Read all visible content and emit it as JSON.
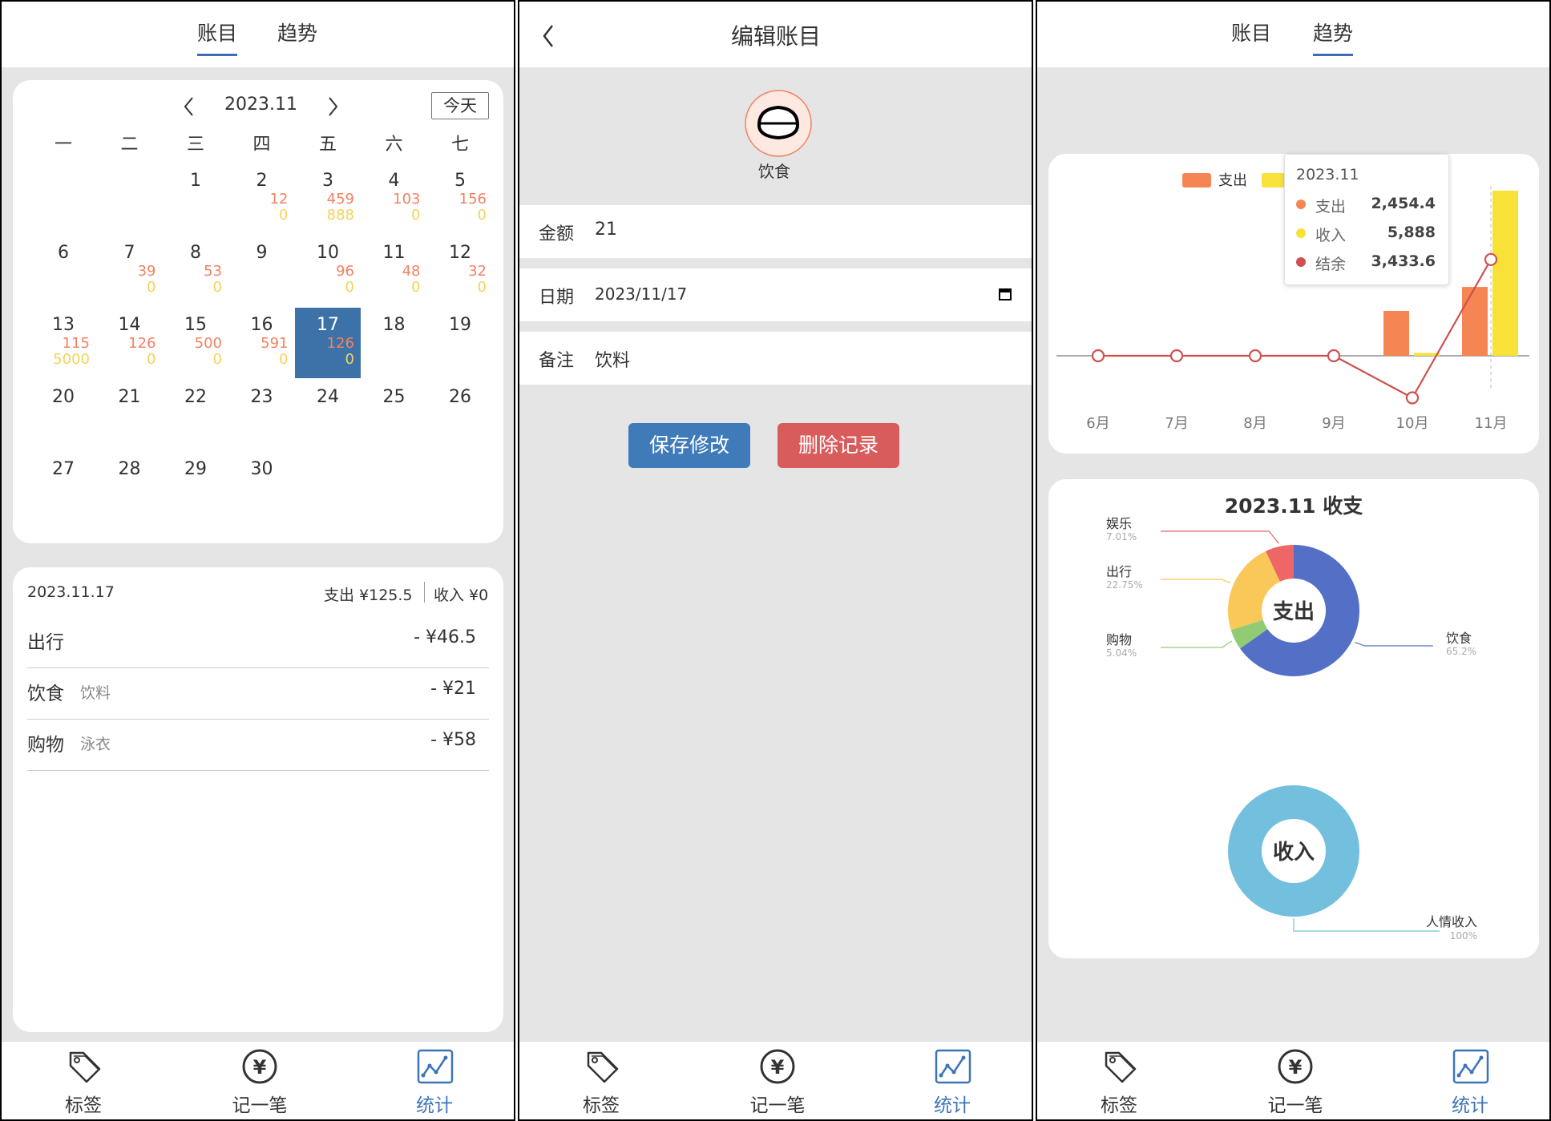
{
  "nav": {
    "items": [
      {
        "label": "标签",
        "icon": "tag-icon"
      },
      {
        "label": "记一笔",
        "icon": "yen-circle-icon"
      },
      {
        "label": "统计",
        "icon": "chart-icon"
      }
    ],
    "active_color": "#3c74b8"
  },
  "panel1": {
    "tabs": [
      "账目",
      "趋势"
    ],
    "active_tab": "账目",
    "calendar": {
      "month": "2023.11",
      "today_btn": "今天",
      "weekdays": [
        "一",
        "二",
        "三",
        "四",
        "五",
        "六",
        "七"
      ],
      "selected_day": "17",
      "days": [
        {
          "d": "1",
          "col": 2,
          "row": 0,
          "exp": "",
          "inc": ""
        },
        {
          "d": "2",
          "col": 3,
          "row": 0,
          "exp": "12",
          "inc": "0"
        },
        {
          "d": "3",
          "col": 4,
          "row": 0,
          "exp": "459",
          "inc": "888"
        },
        {
          "d": "4",
          "col": 5,
          "row": 0,
          "exp": "103",
          "inc": "0"
        },
        {
          "d": "5",
          "col": 6,
          "row": 0,
          "exp": "156",
          "inc": "0"
        },
        {
          "d": "6",
          "col": 0,
          "row": 1,
          "exp": "",
          "inc": ""
        },
        {
          "d": "7",
          "col": 1,
          "row": 1,
          "exp": "39",
          "inc": "0"
        },
        {
          "d": "8",
          "col": 2,
          "row": 1,
          "exp": "53",
          "inc": "0"
        },
        {
          "d": "9",
          "col": 3,
          "row": 1,
          "exp": "",
          "inc": ""
        },
        {
          "d": "10",
          "col": 4,
          "row": 1,
          "exp": "96",
          "inc": "0"
        },
        {
          "d": "11",
          "col": 5,
          "row": 1,
          "exp": "48",
          "inc": "0"
        },
        {
          "d": "12",
          "col": 6,
          "row": 1,
          "exp": "32",
          "inc": "0"
        },
        {
          "d": "13",
          "col": 0,
          "row": 2,
          "exp": "115",
          "inc": "5000"
        },
        {
          "d": "14",
          "col": 1,
          "row": 2,
          "exp": "126",
          "inc": "0"
        },
        {
          "d": "15",
          "col": 2,
          "row": 2,
          "exp": "500",
          "inc": "0"
        },
        {
          "d": "16",
          "col": 3,
          "row": 2,
          "exp": "591",
          "inc": "0"
        },
        {
          "d": "17",
          "col": 4,
          "row": 2,
          "exp": "126",
          "inc": "0"
        },
        {
          "d": "18",
          "col": 5,
          "row": 2,
          "exp": "",
          "inc": ""
        },
        {
          "d": "19",
          "col": 6,
          "row": 2,
          "exp": "",
          "inc": ""
        },
        {
          "d": "20",
          "col": 0,
          "row": 3,
          "exp": "",
          "inc": ""
        },
        {
          "d": "21",
          "col": 1,
          "row": 3,
          "exp": "",
          "inc": ""
        },
        {
          "d": "22",
          "col": 2,
          "row": 3,
          "exp": "",
          "inc": ""
        },
        {
          "d": "23",
          "col": 3,
          "row": 3,
          "exp": "",
          "inc": ""
        },
        {
          "d": "24",
          "col": 4,
          "row": 3,
          "exp": "",
          "inc": ""
        },
        {
          "d": "25",
          "col": 5,
          "row": 3,
          "exp": "",
          "inc": ""
        },
        {
          "d": "26",
          "col": 6,
          "row": 3,
          "exp": "",
          "inc": ""
        },
        {
          "d": "27",
          "col": 0,
          "row": 4,
          "exp": "",
          "inc": ""
        },
        {
          "d": "28",
          "col": 1,
          "row": 4,
          "exp": "",
          "inc": ""
        },
        {
          "d": "29",
          "col": 2,
          "row": 4,
          "exp": "",
          "inc": ""
        },
        {
          "d": "30",
          "col": 3,
          "row": 4,
          "exp": "",
          "inc": ""
        }
      ]
    },
    "detail": {
      "date": "2023.11.17",
      "expense_summary": "支出 ¥125.5",
      "income_summary": "收入 ¥0",
      "entries": [
        {
          "category": "出行",
          "note": "",
          "amount": "- ¥46.5"
        },
        {
          "category": "饮食",
          "note": "饮料",
          "amount": "- ¥21"
        },
        {
          "category": "购物",
          "note": "泳衣",
          "amount": "- ¥58"
        }
      ]
    }
  },
  "panel2": {
    "title": "编辑账目",
    "category_label": "饮食",
    "amount_label": "金额",
    "amount_value": "21",
    "date_label": "日期",
    "date_value": "2023/11/17",
    "note_label": "备注",
    "note_value": "饮料",
    "save_button": "保存修改",
    "delete_button": "删除记录",
    "save_color": "#3f7bb8",
    "delete_color": "#d95c5c"
  },
  "panel3": {
    "tabs": [
      "账目",
      "趋势"
    ],
    "active_tab": "趋势",
    "tooltip": {
      "title": "2023.11",
      "rows": [
        {
          "name": "支出",
          "value": "2,454.4",
          "color": "#f58552"
        },
        {
          "name": "收入",
          "value": "5,888",
          "color": "#f8e23a"
        },
        {
          "name": "结余",
          "value": "3,433.6",
          "color": "#d05050"
        }
      ]
    },
    "donut_expense_center": "支出",
    "donut_income_center": "收入"
  },
  "chart_data": [
    {
      "type": "bar",
      "categories": [
        "6月",
        "7月",
        "8月",
        "9月",
        "10月",
        "11月"
      ],
      "legend": [
        "支出",
        "收入"
      ],
      "series": [
        {
          "name": "支出",
          "kind": "bar",
          "color": "#f58552",
          "values": [
            0,
            0,
            0,
            0,
            1600,
            2454.4
          ]
        },
        {
          "name": "收入",
          "kind": "bar",
          "color": "#f8e23a",
          "values": [
            0,
            0,
            0,
            0,
            100,
            5888
          ]
        },
        {
          "name": "结余",
          "kind": "line",
          "color": "#d05050",
          "values": [
            0,
            0,
            0,
            0,
            -1500,
            3433.6
          ]
        }
      ],
      "ylim": [
        -1600,
        6000
      ],
      "legend_position": "top-left",
      "grid": false
    },
    {
      "type": "pie",
      "title": "2023.11 收支",
      "center_label": "支出",
      "slices": [
        {
          "label": "饮食",
          "percent": "65.2%",
          "value": 65.2,
          "color": "#5470c6"
        },
        {
          "label": "购物",
          "percent": "5.04%",
          "value": 5.04,
          "color": "#91cc75"
        },
        {
          "label": "出行",
          "percent": "22.75%",
          "value": 22.75,
          "color": "#fac858"
        },
        {
          "label": "娱乐",
          "percent": "7.01%",
          "value": 7.01,
          "color": "#ee6666"
        }
      ]
    },
    {
      "type": "pie",
      "center_label": "收入",
      "slices": [
        {
          "label": "人情收入",
          "percent": "100%",
          "value": 100,
          "color": "#73c0de"
        }
      ]
    }
  ]
}
